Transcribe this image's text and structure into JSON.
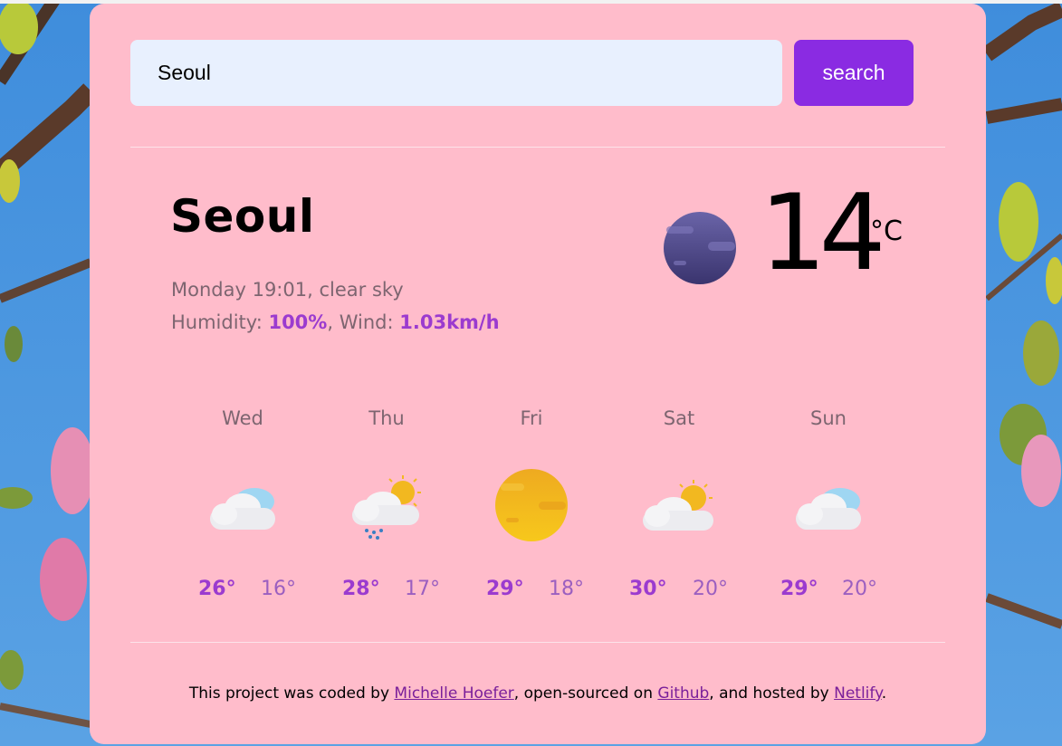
{
  "search": {
    "value": "Seoul",
    "button_label": "search"
  },
  "current": {
    "city": "Seoul",
    "datetime": "Monday 19:01",
    "description": "clear sky",
    "humidity_label": "Humidity:",
    "humidity": "100%",
    "wind_label": "Wind:",
    "wind": "1.03km/h",
    "temperature": "14",
    "unit": "°C",
    "icon": "clear-night-icon"
  },
  "forecast": [
    {
      "day": "Wed",
      "max": "26°",
      "min": "16°",
      "icon": "cloudy-icon"
    },
    {
      "day": "Thu",
      "max": "28°",
      "min": "17°",
      "icon": "rain-sun-cloud-icon"
    },
    {
      "day": "Fri",
      "max": "29°",
      "min": "18°",
      "icon": "sun-icon"
    },
    {
      "day": "Sat",
      "max": "30°",
      "min": "20°",
      "icon": "partly-cloudy-icon"
    },
    {
      "day": "Sun",
      "max": "29°",
      "min": "20°",
      "icon": "cloudy-icon"
    }
  ],
  "footer": {
    "text1": "This project was coded by ",
    "author": "Michelle Hoefer",
    "text2": ", open-sourced on ",
    "github": "Github",
    "text3": ", and hosted by ",
    "netlify": "Netlify",
    "text4": "."
  },
  "colors": {
    "card": "#ffbccb",
    "accent": "#8a2be2",
    "input_bg": "#e8f0fe"
  }
}
